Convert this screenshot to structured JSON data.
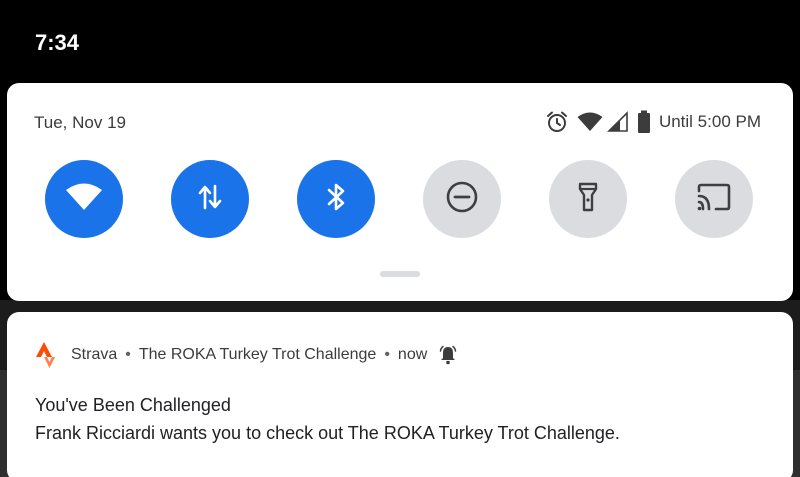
{
  "status_bar": {
    "time": "7:34"
  },
  "quick_settings": {
    "date": "Tue, Nov 19",
    "battery_label": "Until 5:00 PM",
    "status_icons": [
      "alarm-icon",
      "wifi-signal-icon",
      "cell-signal-icon",
      "battery-icon"
    ],
    "tiles": [
      {
        "name": "wifi",
        "icon": "wifi-icon",
        "state": "on"
      },
      {
        "name": "mobile-data",
        "icon": "data-arrows-icon",
        "state": "on"
      },
      {
        "name": "bluetooth",
        "icon": "bluetooth-icon",
        "state": "on"
      },
      {
        "name": "do-not-disturb",
        "icon": "dnd-icon",
        "state": "off"
      },
      {
        "name": "flashlight",
        "icon": "flashlight-icon",
        "state": "off"
      },
      {
        "name": "cast",
        "icon": "cast-icon",
        "state": "off"
      }
    ],
    "colors": {
      "tile_on": "#1a73e8",
      "tile_off": "#dadce0"
    }
  },
  "notification": {
    "app_name": "Strava",
    "channel": "The ROKA Turkey Trot Challenge",
    "time": "now",
    "separator": "•",
    "title": "You've Been Challenged",
    "body": "Frank Ricciardi wants you to check out The ROKA Turkey Trot Challenge.",
    "app_color": "#fc4c02"
  }
}
